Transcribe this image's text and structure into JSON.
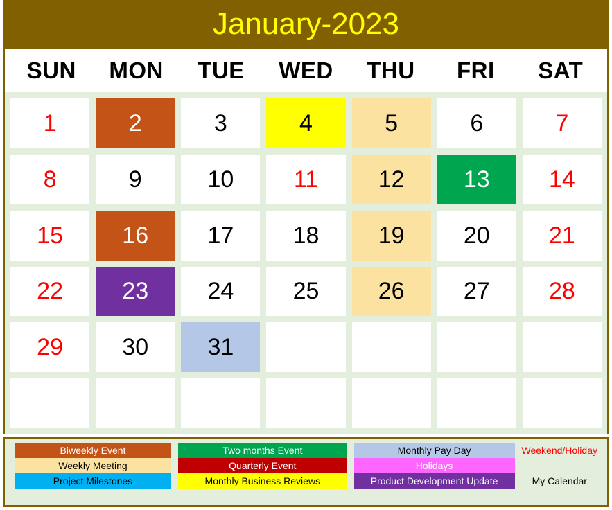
{
  "header": {
    "title": "January-2023",
    "title_color": "#ffff00",
    "bar_color": "#806000"
  },
  "weekdays": [
    "SUN",
    "MON",
    "TUE",
    "WED",
    "THU",
    "FRI",
    "SAT"
  ],
  "colors": {
    "grid_background": "#e3eedc",
    "cell_default": "#ffffff",
    "weekend_text": "#ff0000",
    "weekday_text": "#000000",
    "border": "#806000",
    "biweekly_event": "#c35317",
    "weekly_meeting": "#fbe2a0",
    "project_milestones": "#00b0f0",
    "two_months_event": "#00a550",
    "quarterly_event": "#c00000",
    "monthly_business_reviews": "#ffff00",
    "monthly_pay_day": "#b4c7e7",
    "holidays": "#ff66ff",
    "product_development_update": "#7030a0"
  },
  "calendar": {
    "weeks": [
      [
        {
          "day": "",
          "bg": "#ffffff",
          "fg": "#000000",
          "empty": true
        },
        {
          "day": "2",
          "bg": "#c35317",
          "fg": "#ffffff",
          "empty": false
        },
        {
          "day": "3",
          "bg": "#ffffff",
          "fg": "#000000",
          "empty": false
        },
        {
          "day": "4",
          "bg": "#ffff00",
          "fg": "#000000",
          "empty": false
        },
        {
          "day": "5",
          "bg": "#fbe2a0",
          "fg": "#000000",
          "empty": false
        },
        {
          "day": "6",
          "bg": "#ffffff",
          "fg": "#000000",
          "empty": false
        },
        {
          "day": "7",
          "bg": "#ffffff",
          "fg": "#ff0000",
          "empty": false
        }
      ],
      [
        {
          "day": "8",
          "bg": "#ffffff",
          "fg": "#ff0000",
          "empty": false
        },
        {
          "day": "9",
          "bg": "#ffffff",
          "fg": "#000000",
          "empty": false
        },
        {
          "day": "10",
          "bg": "#ffffff",
          "fg": "#000000",
          "empty": false
        },
        {
          "day": "11",
          "bg": "#ffffff",
          "fg": "#ff0000",
          "empty": false
        },
        {
          "day": "12",
          "bg": "#fbe2a0",
          "fg": "#000000",
          "empty": false
        },
        {
          "day": "13",
          "bg": "#00a550",
          "fg": "#ffffff",
          "empty": false
        },
        {
          "day": "14",
          "bg": "#ffffff",
          "fg": "#ff0000",
          "empty": false
        }
      ],
      [
        {
          "day": "15",
          "bg": "#ffffff",
          "fg": "#ff0000",
          "empty": false
        },
        {
          "day": "16",
          "bg": "#c35317",
          "fg": "#ffffff",
          "empty": false
        },
        {
          "day": "17",
          "bg": "#ffffff",
          "fg": "#000000",
          "empty": false
        },
        {
          "day": "18",
          "bg": "#ffffff",
          "fg": "#000000",
          "empty": false
        },
        {
          "day": "19",
          "bg": "#fbe2a0",
          "fg": "#000000",
          "empty": false
        },
        {
          "day": "20",
          "bg": "#ffffff",
          "fg": "#000000",
          "empty": false
        },
        {
          "day": "21",
          "bg": "#ffffff",
          "fg": "#ff0000",
          "empty": false
        }
      ],
      [
        {
          "day": "22",
          "bg": "#ffffff",
          "fg": "#ff0000",
          "empty": false
        },
        {
          "day": "23",
          "bg": "#7030a0",
          "fg": "#ffffff",
          "empty": false
        },
        {
          "day": "24",
          "bg": "#ffffff",
          "fg": "#000000",
          "empty": false
        },
        {
          "day": "25",
          "bg": "#ffffff",
          "fg": "#000000",
          "empty": false
        },
        {
          "day": "26",
          "bg": "#fbe2a0",
          "fg": "#000000",
          "empty": false
        },
        {
          "day": "27",
          "bg": "#ffffff",
          "fg": "#000000",
          "empty": false
        },
        {
          "day": "28",
          "bg": "#ffffff",
          "fg": "#ff0000",
          "empty": false
        }
      ],
      [
        {
          "day": "29",
          "bg": "#ffffff",
          "fg": "#ff0000",
          "empty": false
        },
        {
          "day": "30",
          "bg": "#ffffff",
          "fg": "#000000",
          "empty": false
        },
        {
          "day": "31",
          "bg": "#b4c7e7",
          "fg": "#000000",
          "empty": false
        },
        {
          "day": "",
          "bg": "#ffffff",
          "fg": "#000000",
          "empty": true
        },
        {
          "day": "",
          "bg": "#ffffff",
          "fg": "#000000",
          "empty": true
        },
        {
          "day": "",
          "bg": "#ffffff",
          "fg": "#000000",
          "empty": true
        },
        {
          "day": "",
          "bg": "#ffffff",
          "fg": "#000000",
          "empty": true
        }
      ],
      [
        {
          "day": "",
          "bg": "#ffffff",
          "fg": "#000000",
          "empty": true
        },
        {
          "day": "",
          "bg": "#ffffff",
          "fg": "#000000",
          "empty": true
        },
        {
          "day": "",
          "bg": "#ffffff",
          "fg": "#000000",
          "empty": true
        },
        {
          "day": "",
          "bg": "#ffffff",
          "fg": "#000000",
          "empty": true
        },
        {
          "day": "",
          "bg": "#ffffff",
          "fg": "#000000",
          "empty": true
        },
        {
          "day": "",
          "bg": "#ffffff",
          "fg": "#000000",
          "empty": true
        },
        {
          "day": "",
          "bg": "#ffffff",
          "fg": "#000000",
          "empty": true
        }
      ]
    ],
    "first_cell_day1": {
      "day": "1",
      "bg": "#ffffff",
      "fg": "#ff0000"
    }
  },
  "legend": {
    "columns": [
      [
        {
          "label": "Biweekly Event",
          "bg": "#c35317",
          "fg": "#ffffff"
        },
        {
          "label": "Weekly Meeting",
          "bg": "#fbe2a0",
          "fg": "#000000"
        },
        {
          "label": "Project Milestones",
          "bg": "#00b0f0",
          "fg": "#000000"
        }
      ],
      [
        {
          "label": "Two months Event",
          "bg": "#00a550",
          "fg": "#ffffff"
        },
        {
          "label": "Quarterly Event",
          "bg": "#c00000",
          "fg": "#ffffff"
        },
        {
          "label": "Monthly Business Reviews",
          "bg": "#ffff00",
          "fg": "#000000"
        }
      ],
      [
        {
          "label": "Monthly Pay Day",
          "bg": "#b4c7e7",
          "fg": "#000000"
        },
        {
          "label": "Holidays",
          "bg": "#ff66ff",
          "fg": "#ffffff"
        },
        {
          "label": "Product Development Update",
          "bg": "#7030a0",
          "fg": "#ffffff"
        }
      ]
    ],
    "notes": [
      {
        "label": "Weekend/Holiday",
        "fg": "#ff0000"
      },
      {
        "label": "",
        "fg": "#000000"
      },
      {
        "label": "My Calendar",
        "fg": "#000000"
      }
    ]
  }
}
